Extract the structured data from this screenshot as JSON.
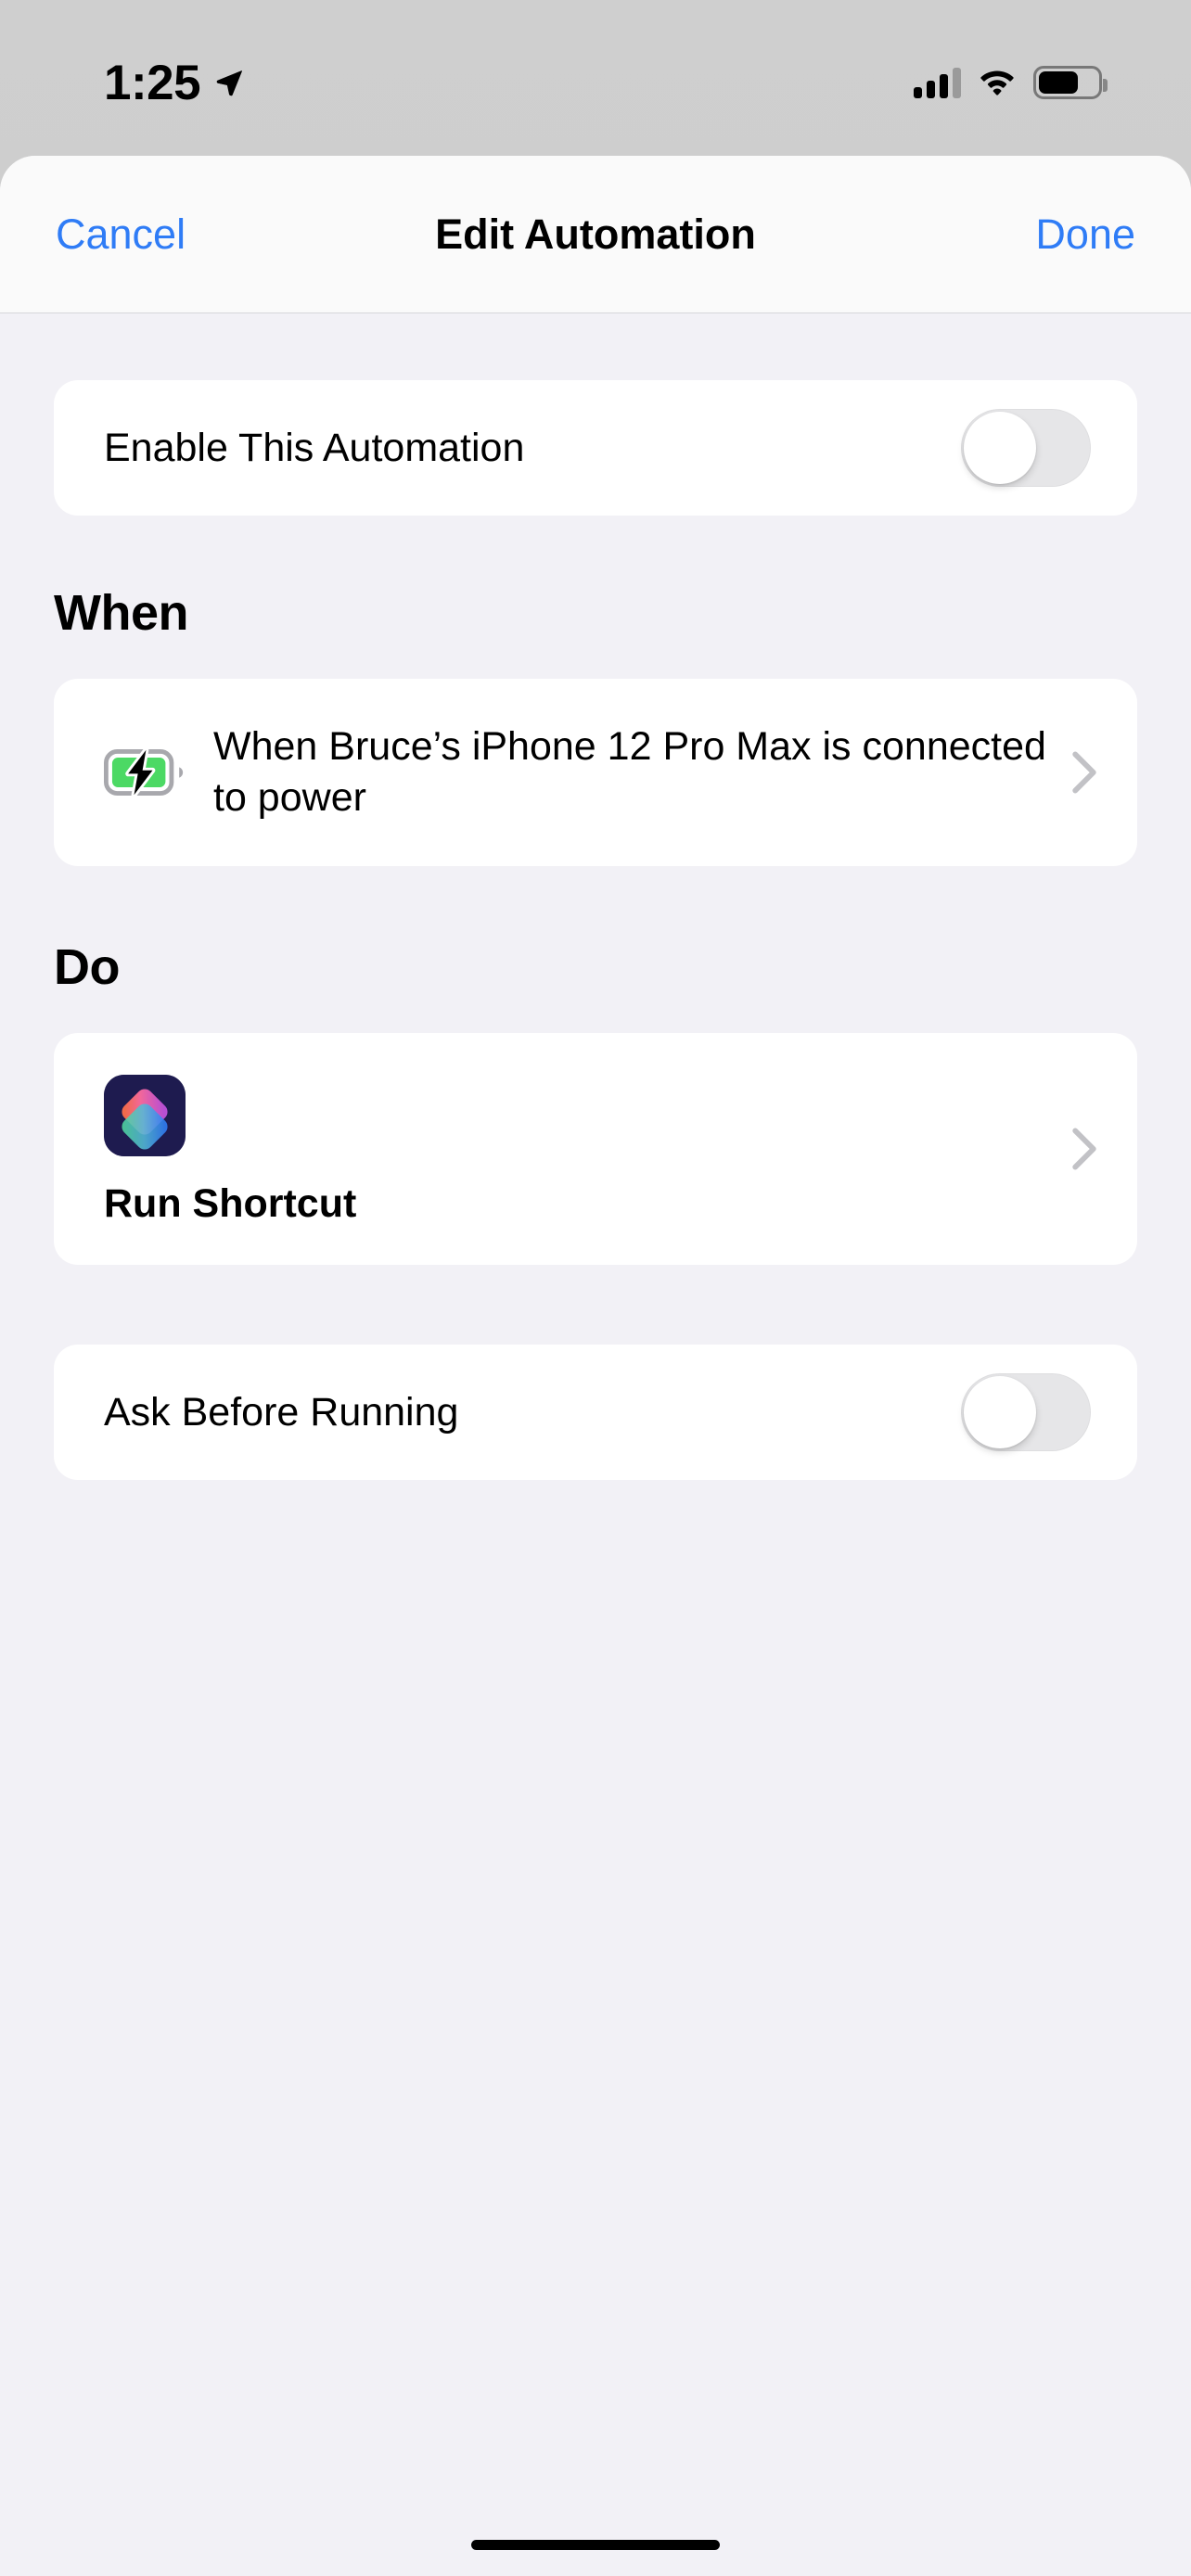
{
  "status_bar": {
    "time": "1:25",
    "location_icon": "location-arrow-icon",
    "cellular_icon": "cellular-signal-icon",
    "wifi_icon": "wifi-icon",
    "battery_icon": "battery-icon"
  },
  "nav": {
    "cancel_label": "Cancel",
    "title": "Edit Automation",
    "done_label": "Done",
    "accent_color": "#2f7cf6"
  },
  "enable_section": {
    "label": "Enable This Automation",
    "toggle_state": "off"
  },
  "when_section": {
    "header": "When",
    "trigger_icon": "battery-charging-icon",
    "trigger_text": "When Bruce’s iPhone 12 Pro Max is connected to power",
    "chevron_icon": "chevron-right-icon"
  },
  "do_section": {
    "header": "Do",
    "app_icon": "shortcuts-app-icon",
    "action_title": "Run Shortcut",
    "chevron_icon": "chevron-right-icon"
  },
  "ask_section": {
    "label": "Ask Before Running",
    "toggle_state": "off"
  },
  "colors": {
    "background": "#f2f1f6",
    "card": "#ffffff",
    "accent": "#2f7cf6",
    "switch_off_track": "#e6e6e8",
    "battery_green": "#4cd964",
    "shortcuts_navy": "#1e1b4f"
  }
}
